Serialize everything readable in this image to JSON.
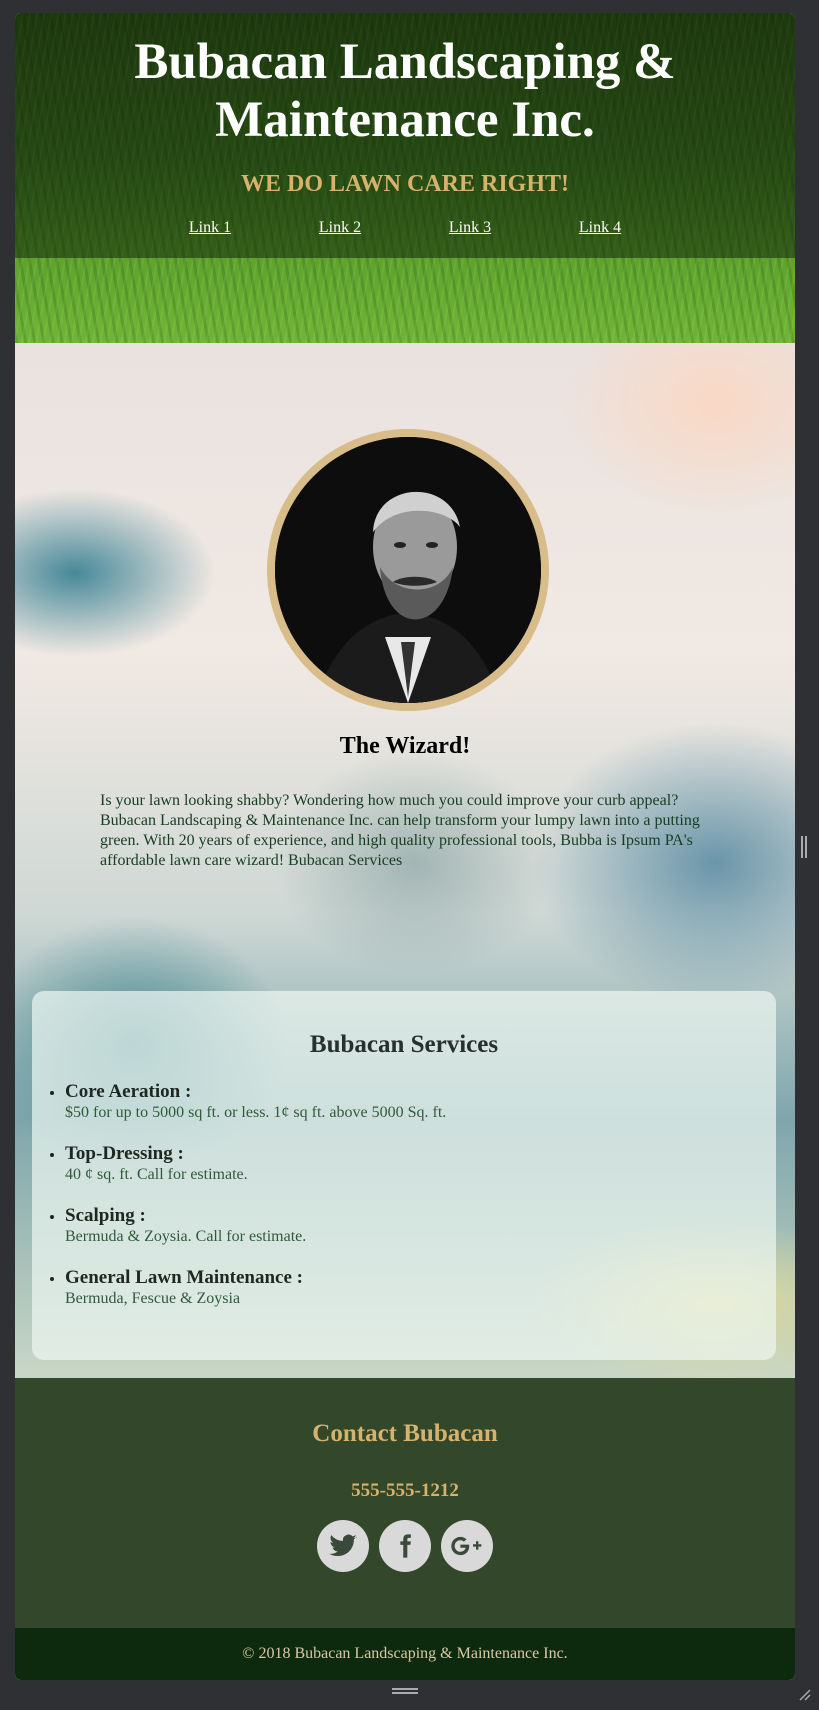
{
  "header": {
    "title": "Bubacan Landscaping & Maintenance Inc.",
    "tagline": "WE DO LAWN CARE RIGHT!",
    "nav": [
      "Link 1",
      "Link 2",
      "Link 3",
      "Link 4"
    ]
  },
  "about": {
    "photo_icon": "portrait-photo",
    "title": "The Wizard!",
    "text": "Is your lawn looking shabby? Wondering how much you could improve your curb appeal? Bubacan Landscaping & Maintenance Inc. can help transform your lumpy lawn into a putting green. With 20 years of experience, and high quality professional tools, Bubba is Ipsum PA's affordable lawn care wizard! Bubacan Services"
  },
  "services": {
    "title": "Bubacan Services",
    "items": [
      {
        "name": "Core Aeration :",
        "desc": "$50 for up to 5000 sq ft. or less. 1¢ sq ft. above 5000 Sq. ft."
      },
      {
        "name": "Top-Dressing :",
        "desc": "40 ¢ sq. ft. Call for estimate."
      },
      {
        "name": "Scalping :",
        "desc": "Bermuda & Zoysia. Call for estimate."
      },
      {
        "name": "General Lawn Maintenance :",
        "desc": "Bermuda, Fescue & Zoysia"
      }
    ]
  },
  "contact": {
    "title": "Contact Bubacan",
    "phone": "555-555-1212",
    "socials": [
      "twitter-icon",
      "facebook-icon",
      "google-plus-icon"
    ]
  },
  "footer": {
    "copyright": "© 2018 Bubacan Landscaping & Maintenance Inc."
  },
  "colors": {
    "accent_gold": "#d7b26c",
    "contact_bg": "#33482a",
    "footer_bg": "#0e2a0e"
  }
}
